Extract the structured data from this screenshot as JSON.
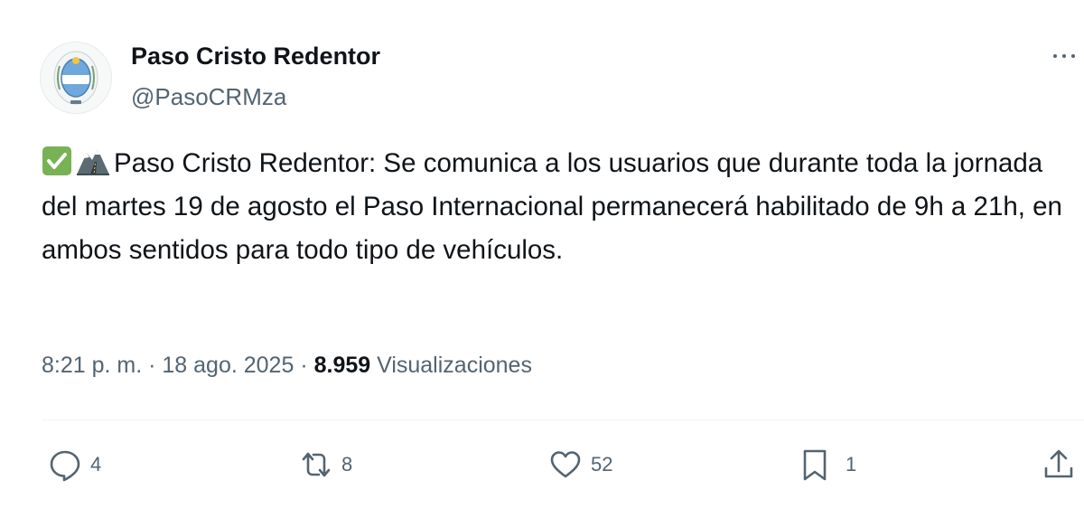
{
  "author": {
    "name": "Paso Cristo Redentor",
    "handle": "@PasoCRMza",
    "avatar_icon": "provincial-seal-icon"
  },
  "tweet": {
    "emojis": [
      "check-mark-button-icon",
      "mountain-road-icon"
    ],
    "text": "Paso Cristo Redentor: Se comunica a los usuarios que durante toda la jornada del martes 19 de agosto el Paso Internacional permanecerá habilitado de 9h a 21h, en ambos sentidos para todo tipo de vehículos."
  },
  "meta": {
    "time": "8:21 p. m.",
    "separator1": " · ",
    "date": "18 ago. 2025",
    "separator2": " · ",
    "views_count": "8.959",
    "views_label": " Visualizaciones"
  },
  "actions": {
    "replies": "4",
    "reposts": "8",
    "likes": "52",
    "bookmarks": "1"
  },
  "colors": {
    "text_primary": "#0f1419",
    "text_secondary": "#536471",
    "divider": "#eff3f4",
    "check_green": "#77b255"
  }
}
